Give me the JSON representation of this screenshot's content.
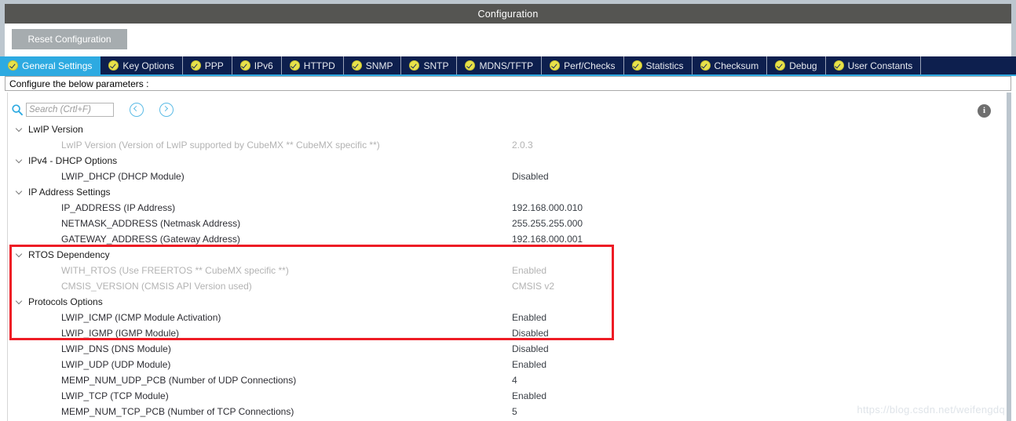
{
  "window": {
    "title": "Configuration"
  },
  "toolbar": {
    "reset_label": "Reset Configuration"
  },
  "tabs": [
    {
      "label": "General Settings",
      "active": true
    },
    {
      "label": "Key Options",
      "active": false
    },
    {
      "label": "PPP",
      "active": false
    },
    {
      "label": "IPv6",
      "active": false
    },
    {
      "label": "HTTPD",
      "active": false
    },
    {
      "label": "SNMP",
      "active": false
    },
    {
      "label": "SNTP",
      "active": false
    },
    {
      "label": "MDNS/TFTP",
      "active": false
    },
    {
      "label": "Perf/Checks",
      "active": false
    },
    {
      "label": "Statistics",
      "active": false
    },
    {
      "label": "Checksum",
      "active": false
    },
    {
      "label": "Debug",
      "active": false
    },
    {
      "label": "User Constants",
      "active": false
    }
  ],
  "configure_bar": {
    "text": "Configure the below parameters :"
  },
  "search": {
    "placeholder": "Search (Crtl+F)",
    "value": "",
    "prev_icon": "chevron-left-circle-icon",
    "next_icon": "chevron-right-circle-icon",
    "search_icon": "search-icon"
  },
  "info": {
    "glyph": "i"
  },
  "tree": [
    {
      "type": "group",
      "label": "LwIP Version",
      "value": "",
      "dim": false
    },
    {
      "type": "item",
      "label": "LwIP Version (Version of LwIP supported by CubeMX ** CubeMX specific **)",
      "value": "2.0.3",
      "dim": true
    },
    {
      "type": "group",
      "label": "IPv4 - DHCP Options",
      "value": "",
      "dim": false
    },
    {
      "type": "item",
      "label": "LWIP_DHCP (DHCP Module)",
      "value": "Disabled",
      "dim": false
    },
    {
      "type": "group",
      "label": "IP Address Settings",
      "value": "",
      "dim": false
    },
    {
      "type": "item",
      "label": "IP_ADDRESS (IP Address)",
      "value": "192.168.000.010",
      "dim": false
    },
    {
      "type": "item",
      "label": "NETMASK_ADDRESS (Netmask Address)",
      "value": "255.255.255.000",
      "dim": false
    },
    {
      "type": "item",
      "label": "GATEWAY_ADDRESS (Gateway Address)",
      "value": "192.168.000.001",
      "dim": false
    },
    {
      "type": "group",
      "label": "RTOS Dependency",
      "value": "",
      "dim": false
    },
    {
      "type": "item",
      "label": "WITH_RTOS (Use FREERTOS ** CubeMX specific **)",
      "value": "Enabled",
      "dim": true
    },
    {
      "type": "item",
      "label": "CMSIS_VERSION (CMSIS API Version used)",
      "value": "CMSIS v2",
      "dim": true
    },
    {
      "type": "group",
      "label": "Protocols Options",
      "value": "",
      "dim": false
    },
    {
      "type": "item",
      "label": "LWIP_ICMP (ICMP Module Activation)",
      "value": "Enabled",
      "dim": false
    },
    {
      "type": "item",
      "label": "LWIP_IGMP (IGMP Module)",
      "value": "Disabled",
      "dim": false
    },
    {
      "type": "item",
      "label": "LWIP_DNS (DNS Module)",
      "value": "Disabled",
      "dim": false
    },
    {
      "type": "item",
      "label": "LWIP_UDP (UDP Module)",
      "value": "Enabled",
      "dim": false
    },
    {
      "type": "item",
      "label": "MEMP_NUM_UDP_PCB (Number of UDP Connections)",
      "value": "4",
      "dim": false
    },
    {
      "type": "item",
      "label": "LWIP_TCP (TCP Module)",
      "value": "Enabled",
      "dim": false
    },
    {
      "type": "item",
      "label": "MEMP_NUM_TCP_PCB (Number of TCP Connections)",
      "value": "5",
      "dim": false
    }
  ],
  "highlight": {
    "color": "#ee1c25"
  },
  "watermark": {
    "text": "https://blog.csdn.net/weifengdq"
  },
  "colors": {
    "titlebar": "#555552",
    "active_tab": "#2daae1",
    "inactive_tab": "#0d1f4e",
    "tab_check": "#e8e24a",
    "window_chrome": "#bcc6ce"
  }
}
